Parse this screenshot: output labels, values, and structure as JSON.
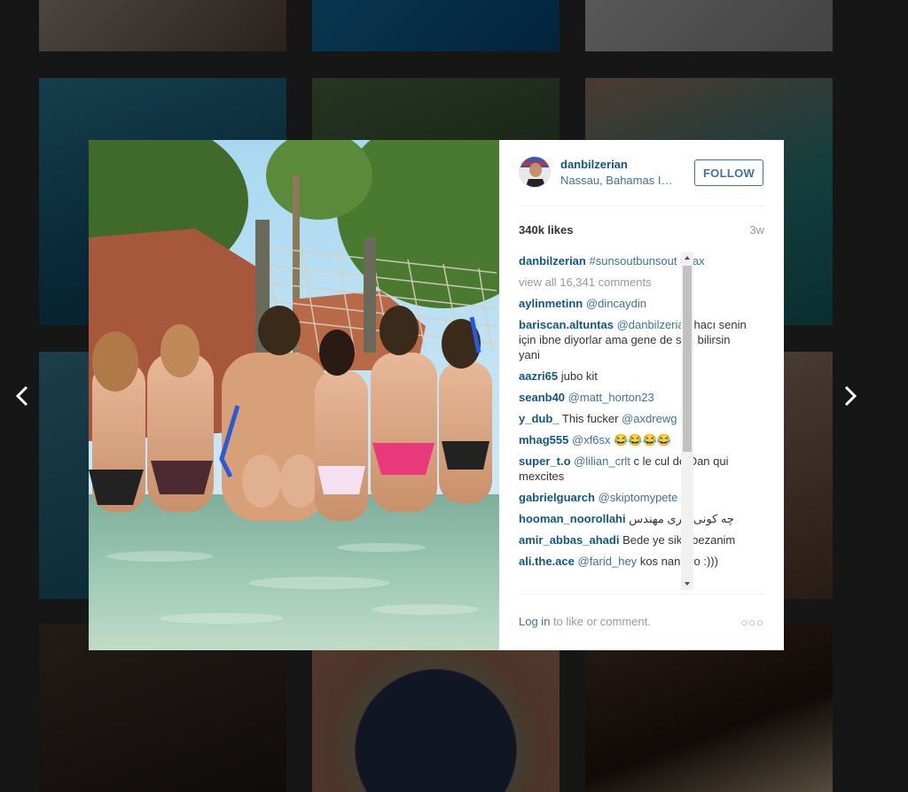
{
  "post": {
    "username": "danbilzerian",
    "location": "Nassau, Bahamas Islands",
    "follow_label": "FOLLOW",
    "likes": "340k likes",
    "time": "3w",
    "caption_user": "danbilzerian",
    "caption_text": "#sunsoutbunsout #Jax",
    "view_all": "view all 16,341 comments"
  },
  "comments": [
    {
      "user": "aylinmetinn",
      "mention": "@dincaydin",
      "text": ""
    },
    {
      "user": "bariscan.altuntas",
      "mention": "@danbilzerian",
      "text": "hacı senin için ibne diyorlar ama gene de sen bilirsin yani"
    },
    {
      "user": "aazri65",
      "mention": "",
      "text": "jubo kit"
    },
    {
      "user": "seanb40",
      "mention": "@matt_horton23",
      "text": ""
    },
    {
      "user": "y_dub_",
      "mention": "",
      "text": "This fucker",
      "mention2": "@axdrewg"
    },
    {
      "user": "mhag555",
      "mention": "@xf6sx",
      "text": "😂😂😂😂"
    },
    {
      "user": "super_t.o",
      "mention": "@lilian_crlt",
      "text": "c le cul de Dan qui mexcites"
    },
    {
      "user": "gabrielguarch",
      "mention": "@skiptomypete",
      "text": ""
    },
    {
      "user": "hooman_noorollahi",
      "mention": "",
      "text": "چه کونی داری مهندس"
    },
    {
      "user": "amir_abbas_ahadi",
      "mention": "",
      "text": "Bede ye sikh bezanim"
    },
    {
      "user": "ali.the.ace",
      "mention": "@farid_hey",
      "text": "kos nane ro :)))"
    }
  ],
  "footer": {
    "login_link": "Log in",
    "login_rest": " to like or comment.",
    "more": "○○○"
  },
  "icons": {
    "prev": "chevron-left-icon",
    "next": "chevron-right-icon"
  }
}
